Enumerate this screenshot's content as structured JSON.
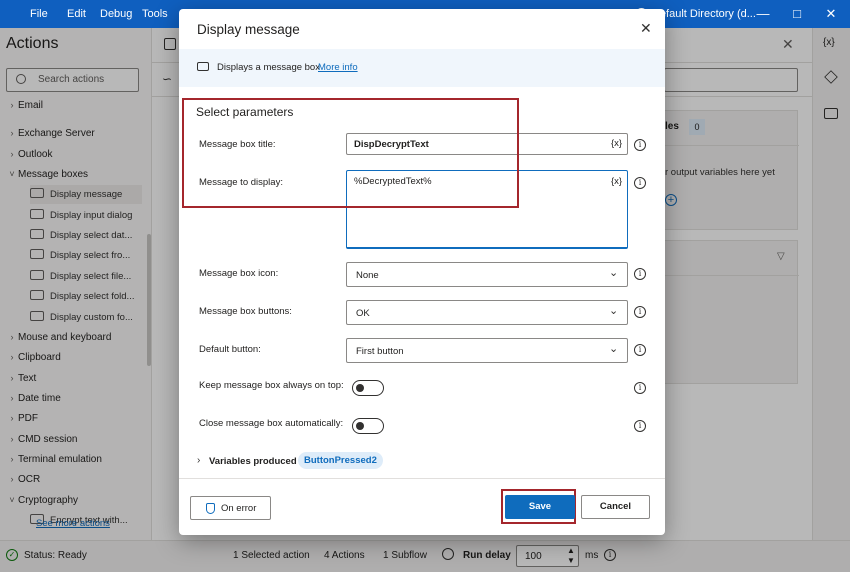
{
  "menu": {
    "file": "File",
    "edit": "Edit",
    "debug": "Debug",
    "tools": "Tools",
    "account": "Default Directory (d..."
  },
  "left_pane": {
    "title": "Actions",
    "search_placeholder": "Search actions",
    "items": [
      {
        "label": "Email",
        "type": "partial"
      },
      {
        "label": "Exchange Server",
        "type": "group"
      },
      {
        "label": "Outlook",
        "type": "group"
      },
      {
        "label": "Message boxes",
        "type": "group-open"
      },
      {
        "label": "Display message",
        "type": "leaf"
      },
      {
        "label": "Display input dialog",
        "type": "leaf"
      },
      {
        "label": "Display select dat...",
        "type": "leaf"
      },
      {
        "label": "Display select fro...",
        "type": "leaf"
      },
      {
        "label": "Display select file...",
        "type": "leaf"
      },
      {
        "label": "Display select fold...",
        "type": "leaf"
      },
      {
        "label": "Display custom fo...",
        "type": "leaf"
      },
      {
        "label": "Mouse and keyboard",
        "type": "group"
      },
      {
        "label": "Clipboard",
        "type": "group"
      },
      {
        "label": "Text",
        "type": "group"
      },
      {
        "label": "Date time",
        "type": "group"
      },
      {
        "label": "PDF",
        "type": "group"
      },
      {
        "label": "CMD session",
        "type": "group"
      },
      {
        "label": "Terminal emulation",
        "type": "group"
      },
      {
        "label": "OCR",
        "type": "group"
      },
      {
        "label": "Cryptography",
        "type": "group-open"
      },
      {
        "label": "Encrypt text with...",
        "type": "leaf"
      }
    ],
    "see_more": "See more actions"
  },
  "background": {
    "variables_label": "les",
    "variables_count": "0",
    "output_vars_text": "r output variables here yet"
  },
  "status": {
    "status_text": "Status: Ready",
    "selected": "1 Selected action",
    "actions": "4 Actions",
    "subflow": "1 Subflow",
    "run_delay_label": "Run delay",
    "run_delay_value": "100",
    "ms": "ms"
  },
  "dialog": {
    "title": "Display message",
    "description": "Displays a message box",
    "more_info": "More info",
    "section": "Select parameters",
    "box_title_label": "Message box title:",
    "box_title_value": "DispDecryptText",
    "message_label": "Message to display:",
    "message_value": "%DecryptedText%",
    "var_icon": "{x}",
    "icon_label": "Message box icon:",
    "icon_value": "None",
    "buttons_label": "Message box buttons:",
    "buttons_value": "OK",
    "default_label": "Default button:",
    "default_value": "First button",
    "on_top_label": "Keep message box always on top:",
    "close_auto_label": "Close message box automatically:",
    "vars_produced": "Variables produced",
    "button_pressed": "ButtonPressed2",
    "on_error": "On error",
    "save": "Save",
    "cancel": "Cancel",
    "info_glyph": "i",
    "accent": "#0f6cbd",
    "highlight": "#a4262c"
  }
}
